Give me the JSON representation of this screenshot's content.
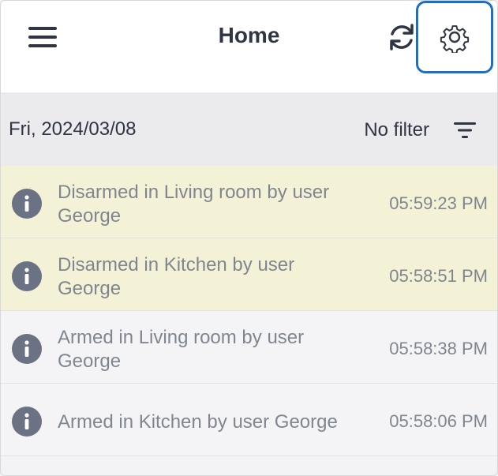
{
  "header": {
    "title": "Home",
    "menu_icon": "hamburger-menu-icon",
    "refresh_icon": "refresh-icon",
    "settings_icon": "gear-icon",
    "settings_highlight_color": "#1d6fc4"
  },
  "filterbar": {
    "date": "Fri, 2024/03/08",
    "filter_label": "No filter",
    "filter_icon": "filter-lines-icon"
  },
  "events": [
    {
      "message": "Disarmed in Living room by user George",
      "time": "05:59:23 PM",
      "highlight": true,
      "icon": "info-icon"
    },
    {
      "message": "Disarmed in Kitchen by user George",
      "time": "05:58:51 PM",
      "highlight": true,
      "icon": "info-icon"
    },
    {
      "message": "Armed in Living room by user George",
      "time": "05:58:38 PM",
      "highlight": false,
      "icon": "info-icon"
    },
    {
      "message": "Armed in Kitchen by user George",
      "time": "05:58:06 PM",
      "highlight": false,
      "icon": "info-icon"
    }
  ],
  "colors": {
    "highlight_row": "#f4f2d6",
    "normal_row": "#f4f4f6",
    "text_dark": "#2f3542",
    "text_muted": "#80868f",
    "icon_fill": "#6b7284"
  }
}
